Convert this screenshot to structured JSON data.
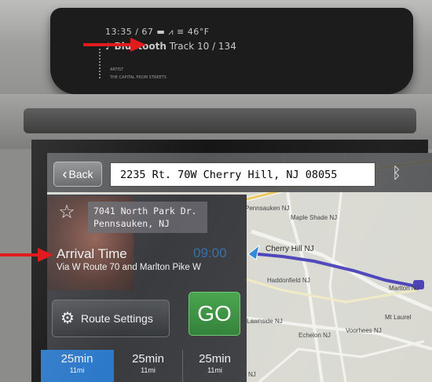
{
  "cluster": {
    "status_line": "13:35 / 67 ▬ ⩘ ≡ 46°F",
    "source_label": "Bluetooth",
    "track_label": "Track 10 / 134",
    "artist_line": "ARTIST",
    "song_line": "THE CAPITAL FROM STREETS"
  },
  "nav": {
    "back_label": "Back",
    "destination_address": "2235 Rt. 70W Cherry Hill, NJ 08055",
    "bluetooth_icon": "bluetooth-icon",
    "saved_place": {
      "line1": "7041 North Park Dr.",
      "line2": "Pennsauken, NJ"
    },
    "arrival_label": "Arrival Time",
    "arrival_time": "09:00",
    "via": "Via W Route 70 and Marlton Pike W",
    "route_settings_label": "Route Settings",
    "go_label": "GO",
    "route_options": [
      {
        "time": "25min",
        "distance": "11mi",
        "selected": true
      },
      {
        "time": "25min",
        "distance": "11mi",
        "selected": false
      },
      {
        "time": "25min",
        "distance": "11mi",
        "selected": false
      }
    ]
  },
  "map": {
    "labels": [
      "Pennsauken NJ",
      "Maple Shade NJ",
      "Cherry Hill NJ",
      "Haddonfield NJ",
      "Marlton NJ",
      "Lawnside NJ",
      "Voorhees NJ",
      "Echelon NJ",
      "Mt Laurel",
      "NJ"
    ]
  },
  "colors": {
    "accent_blue": "#2d79c9",
    "route_line": "#4a41b8",
    "go_green": "#3a9441",
    "annotation_red": "#e11b1b"
  }
}
